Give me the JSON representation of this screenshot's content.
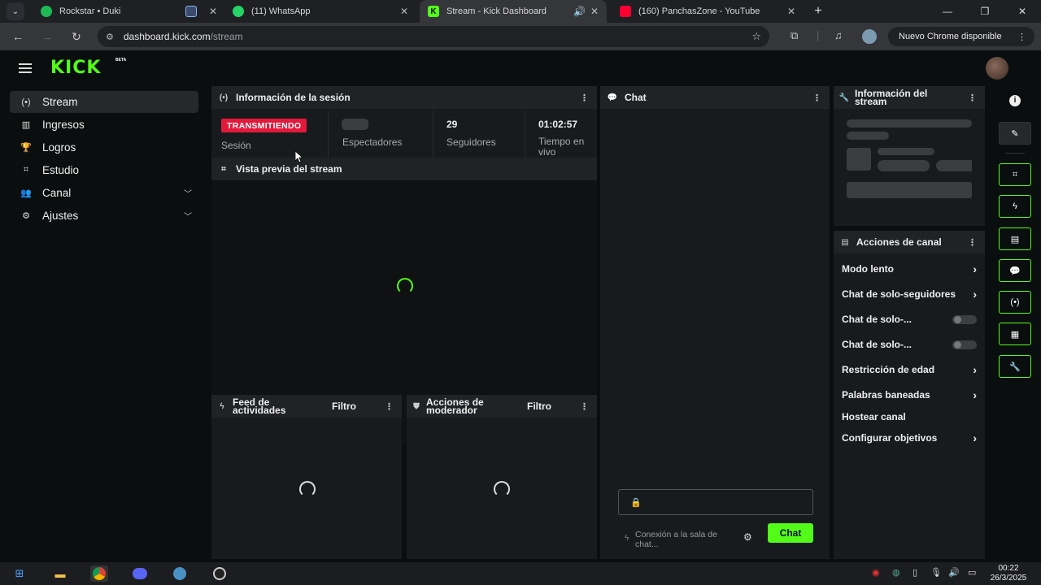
{
  "browser": {
    "tabs": [
      {
        "title": "Rockstar • Duki",
        "icon": "spotify-icon",
        "color": "#1db954"
      },
      {
        "title": "",
        "icon": "cast-icon",
        "color": "#8ab4f8"
      },
      {
        "title": "(11) WhatsApp",
        "icon": "whatsapp-icon",
        "color": "#25d366"
      },
      {
        "title": "Stream - Kick Dashboard",
        "icon": "kick-icon",
        "color": "#53fc18"
      },
      {
        "title": "(160) PanchasZone - YouTube",
        "icon": "youtube-icon",
        "color": "#ff0033"
      }
    ],
    "url_host": "dashboard.kick.com",
    "url_path": "/stream",
    "update_label": "Nuevo Chrome disponible"
  },
  "app": {
    "logo": "KICK",
    "beta": "BETA"
  },
  "sidebar": {
    "items": [
      {
        "label": "Stream"
      },
      {
        "label": "Ingresos"
      },
      {
        "label": "Logros"
      },
      {
        "label": "Estudio"
      },
      {
        "label": "Canal"
      },
      {
        "label": "Ajustes"
      }
    ]
  },
  "session": {
    "title": "Información de la sesión",
    "live_badge": "TRANSMITIENDO",
    "session_label": "Sesión",
    "viewers_label": "Espectadores",
    "followers_value": "29",
    "followers_label": "Seguidores",
    "uptime_value": "01:02:57",
    "uptime_label": "Tiempo en vivo"
  },
  "preview": {
    "title": "Vista previa del stream"
  },
  "feed": {
    "title": "Feed de actividades",
    "filter": "Filtro"
  },
  "modactions": {
    "title": "Acciones de moderador",
    "filter": "Filtro"
  },
  "chat": {
    "title": "Chat",
    "connecting": "Conexión a la sala de chat...",
    "send_label": "Chat"
  },
  "stream_info": {
    "title": "Información del stream"
  },
  "channel_actions": {
    "title": "Acciones de canal",
    "items": [
      {
        "label": "Modo lento"
      },
      {
        "label": "Chat de solo-seguidores"
      },
      {
        "label": "Chat de solo-..."
      },
      {
        "label": "Chat de solo-..."
      },
      {
        "label": "Restricción de edad"
      },
      {
        "label": "Palabras baneadas"
      },
      {
        "label": "Hostear canal"
      },
      {
        "label": "Configurar objetivos"
      }
    ]
  },
  "taskbar": {
    "time": "00:22",
    "date": "26/3/2025"
  }
}
